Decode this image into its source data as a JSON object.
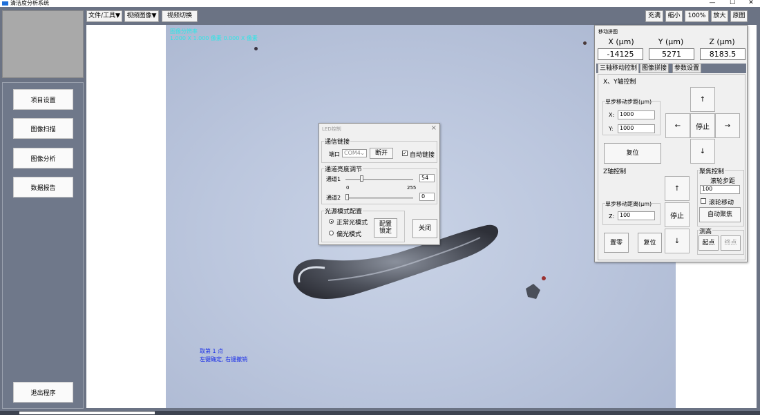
{
  "window": {
    "title": "清洁度分析系统",
    "controls": [
      "—",
      "☐",
      "✕"
    ]
  },
  "sidebar": {
    "buttons": [
      "项目设置",
      "图像扫描",
      "图像分析",
      "数据报告"
    ],
    "exit_label": "退出程序"
  },
  "toolbar": {
    "menus": [
      "文件/工具▼",
      "视频图像▼",
      "视频切换"
    ],
    "right": [
      "充满",
      "缩小",
      "100%",
      "放大",
      "原图"
    ]
  },
  "viewport": {
    "info_line1": "图像分辨率",
    "info_line2": "1.000 X 1.000 像素  0.000 X 像素",
    "hint_line1": "取第 1 点",
    "hint_line2": "左键确定, 右键撤销"
  },
  "led_dialog": {
    "title": "LED控制",
    "comm_group": "通信链接",
    "port_label": "端口",
    "port_value": "COM4",
    "disconnect": "断开",
    "auto_link": "自动链接",
    "brightness_group": "通道亮度调节",
    "ch1_label": "通道1",
    "ch1_value": "54",
    "ch1_fraction": 0.21,
    "range_min": "0",
    "range_max": "255",
    "ch2_label": "通道2",
    "ch2_value": "0",
    "ch2_fraction": 0.0,
    "mode_group": "光源模式配置",
    "mode_normal": "正常光模式",
    "mode_polar": "偏光模式",
    "config_lock": "配置\n锁定",
    "close": "关闭"
  },
  "move_panel": {
    "title": "移动拼图",
    "x_label": "X (μm)",
    "y_label": "Y (μm)",
    "z_label": "Z (μm)",
    "x_value": "-14125",
    "y_value": "5271",
    "z_value": "8183.5",
    "tabs": [
      "三轴移动控制",
      "图像拼接",
      "参数设置"
    ],
    "xy_group": "X、Y轴控制",
    "xy_step_group": "单步移动步距(μm)",
    "x_step_label": "X:",
    "x_step": "1000",
    "y_step_label": "Y:",
    "y_step": "1000",
    "reset": "复位",
    "up": "↑",
    "down": "↓",
    "left": "←",
    "right": "→",
    "stop": "停止",
    "z_group": "Z轴控制",
    "z_step_group": "单步移动距离(μm)",
    "z_step_label": "Z:",
    "z_step": "100",
    "zero": "置零",
    "z_reset": "复位",
    "focus_group": "聚焦控制",
    "wheel_step_label": "滚轮步距",
    "wheel_step": "100",
    "wheel_move": "滚轮移动",
    "auto_focus": "自动聚焦",
    "measure_group": "测高",
    "start_point": "起点",
    "end_point": "终点"
  }
}
